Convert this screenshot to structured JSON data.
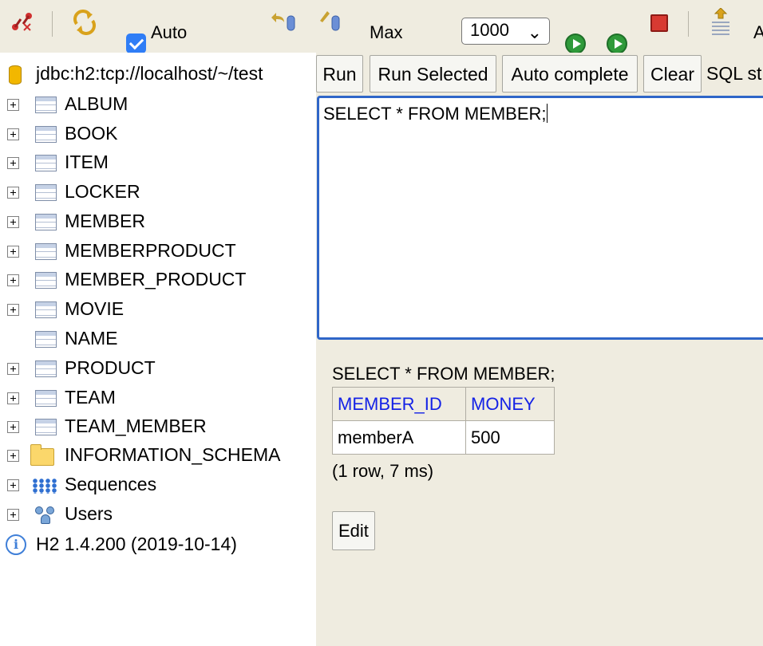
{
  "toolbar": {
    "auto_commit_label": "Auto",
    "auto_commit_checked": true,
    "max_rows_label": "Max",
    "max_rows_value": "1000",
    "max_rows_chevron": "⌄",
    "trailing_label": "A",
    "icons": [
      "disconnect-icon",
      "refresh-icon",
      "rollback-icon",
      "commit-icon",
      "run-icon",
      "run-selected-icon",
      "stop-icon",
      "history-icon"
    ]
  },
  "tree": {
    "connection": "jdbc:h2:tcp://localhost/~/test",
    "items": [
      {
        "label": "ALBUM",
        "kind": "table",
        "expandable": true
      },
      {
        "label": "BOOK",
        "kind": "table",
        "expandable": true
      },
      {
        "label": "ITEM",
        "kind": "table",
        "expandable": true
      },
      {
        "label": "LOCKER",
        "kind": "table",
        "expandable": true
      },
      {
        "label": "MEMBER",
        "kind": "table",
        "expandable": true
      },
      {
        "label": "MEMBERPRODUCT",
        "kind": "table",
        "expandable": true
      },
      {
        "label": "MEMBER_PRODUCT",
        "kind": "table",
        "expandable": true
      },
      {
        "label": "MOVIE",
        "kind": "table",
        "expandable": true
      },
      {
        "label": "NAME",
        "kind": "table",
        "expandable": false
      },
      {
        "label": "PRODUCT",
        "kind": "table",
        "expandable": true
      },
      {
        "label": "TEAM",
        "kind": "table",
        "expandable": true
      },
      {
        "label": "TEAM_MEMBER",
        "kind": "table",
        "expandable": true
      },
      {
        "label": "INFORMATION_SCHEMA",
        "kind": "folder",
        "expandable": true
      },
      {
        "label": "Sequences",
        "kind": "sequences",
        "expandable": true
      },
      {
        "label": "Users",
        "kind": "users",
        "expandable": true
      }
    ],
    "version": "H2 1.4.200 (2019-10-14)",
    "info_glyph": "i"
  },
  "query_panel": {
    "buttons": {
      "run": "Run",
      "run_selected": "Run Selected",
      "auto_complete": "Auto complete",
      "clear": "Clear"
    },
    "sql_label": "SQL st",
    "editor_text": "SELECT * FROM MEMBER;"
  },
  "result": {
    "query": "SELECT * FROM MEMBER;",
    "columns": [
      "MEMBER_ID",
      "MONEY"
    ],
    "rows": [
      [
        "memberA",
        "500"
      ]
    ],
    "stats": "(1 row, 7 ms)",
    "edit_label": "Edit"
  },
  "colors": {
    "panel_bg": "#efece0",
    "editor_border": "#2f66c8",
    "column_header": "#1422e6",
    "checkbox": "#2f7df6"
  }
}
